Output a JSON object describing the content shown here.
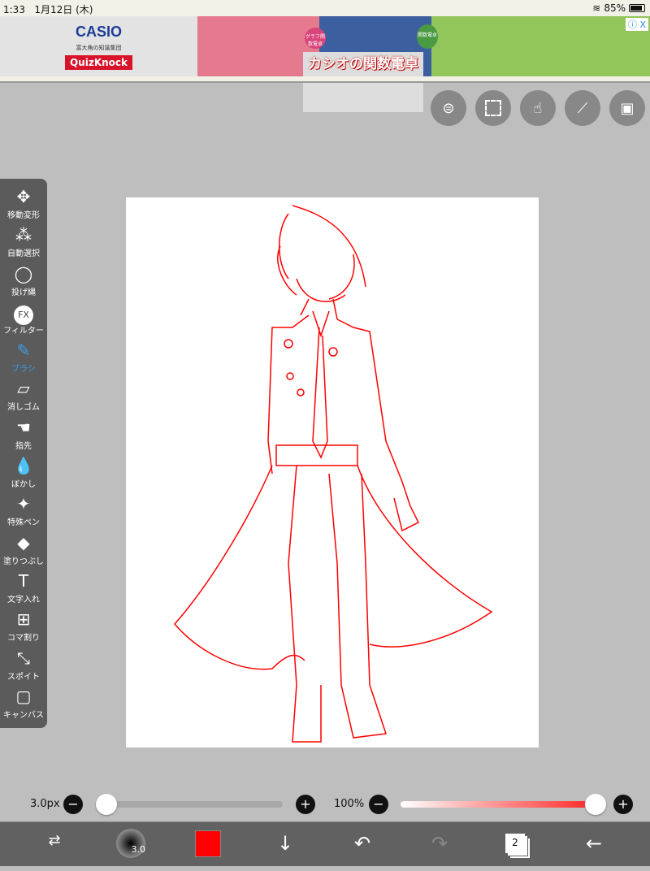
{
  "status": {
    "time": "1:33",
    "date": "1月12日 (木)",
    "battery": "85%",
    "battery_level": 0.85
  },
  "ad": {
    "brand": "CASIO",
    "sub": "富大角の知識集団",
    "quizknock": "QuizKnock",
    "title": "カシオの関数電卓",
    "badge1": "グラフ関数電卓",
    "badge2": "関数電卓",
    "close": "ⓘ X"
  },
  "top_tools": [
    {
      "icon": "toggle-icon"
    },
    {
      "icon": "selection-icon"
    },
    {
      "icon": "touch-icon"
    },
    {
      "icon": "ruler-icon"
    },
    {
      "icon": "image-icon"
    }
  ],
  "sidebar": {
    "items": [
      {
        "label": "移動変形",
        "icon": "move-icon"
      },
      {
        "label": "自動選択",
        "icon": "magic-wand-icon"
      },
      {
        "label": "投げ縄",
        "icon": "lasso-icon"
      },
      {
        "label": "フィルター",
        "icon": "fx-icon",
        "glyph": "FX"
      },
      {
        "label": "ブラシ",
        "icon": "brush-icon",
        "active": true
      },
      {
        "label": "消しゴム",
        "icon": "eraser-icon"
      },
      {
        "label": "指先",
        "icon": "smudge-icon"
      },
      {
        "label": "ぼかし",
        "icon": "blur-icon"
      },
      {
        "label": "特殊ペン",
        "icon": "special-pen-icon"
      },
      {
        "label": "塗りつぶし",
        "icon": "fill-icon"
      },
      {
        "label": "文字入れ",
        "icon": "text-icon"
      },
      {
        "label": "コマ割り",
        "icon": "frame-divider-icon"
      },
      {
        "label": "スポイト",
        "icon": "eyedropper-icon"
      },
      {
        "label": "キャンバス",
        "icon": "canvas-icon"
      }
    ]
  },
  "sliders": {
    "size_label": "3.0px",
    "size_value": 3.0,
    "opacity_label": "100%",
    "opacity_value": 100,
    "minus": "−",
    "plus": "+"
  },
  "bottom": {
    "brush_size": "3.0",
    "layer_count": "2",
    "color": "#ff0000"
  },
  "colors": {
    "accent": "#3aa0f0",
    "brush": "#ff0000"
  }
}
